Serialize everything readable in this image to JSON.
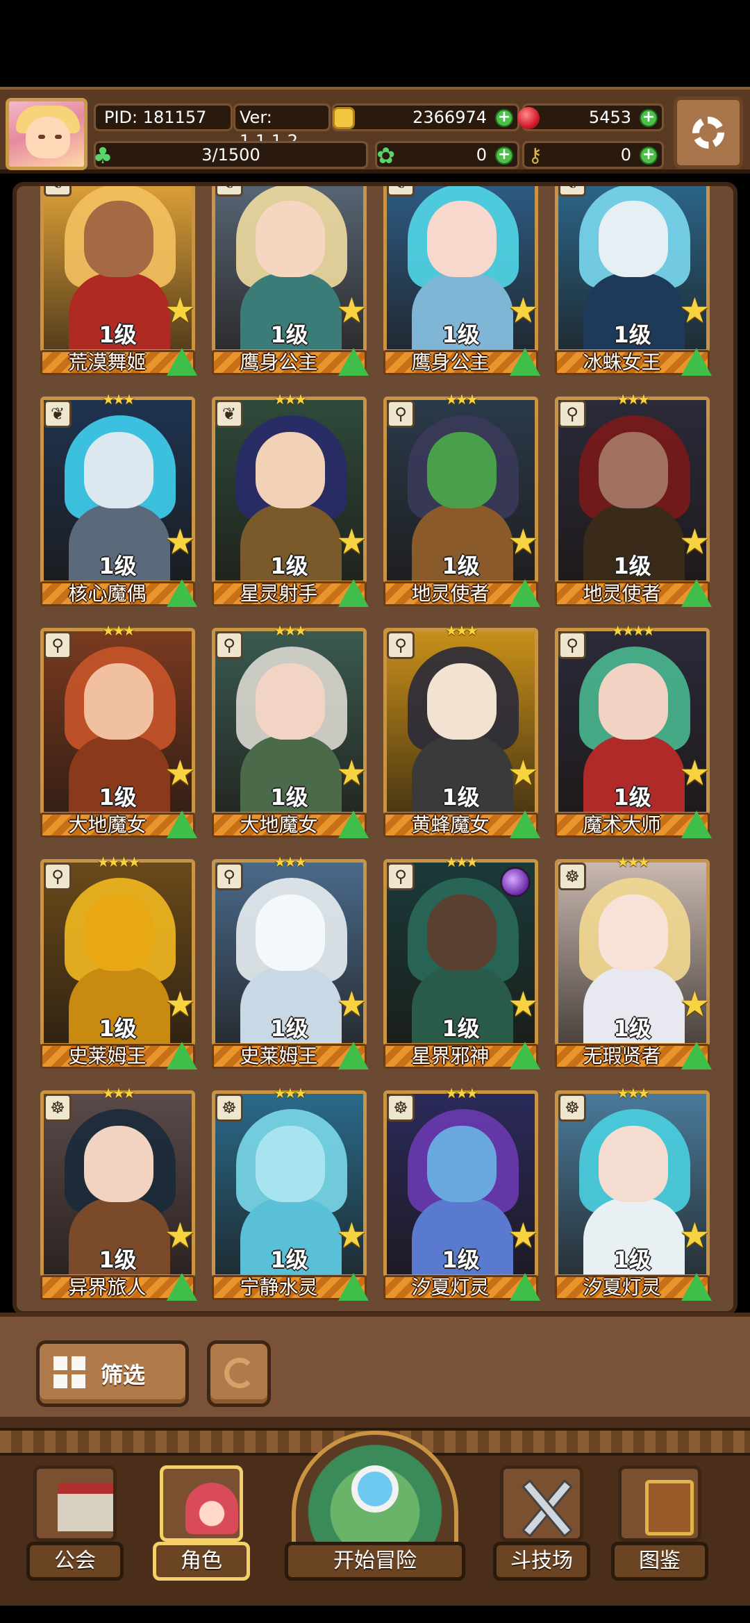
{
  "header": {
    "pid": "PID: 181157",
    "version": "Ver: 1.1.1.2",
    "gold": "2366974",
    "gems": "5453",
    "energy": "3/1500",
    "clover": "0",
    "keys": "0"
  },
  "roster": [
    {
      "level": "1级",
      "name": "荒漠舞姬",
      "stars": "★★★",
      "class_icon": "feather-icon",
      "colors": {
        "bg": "#e8a83a",
        "hair": "#f4c060",
        "skin": "#a56a44",
        "body": "#b02a24"
      }
    },
    {
      "level": "1级",
      "name": "鹰身公主",
      "stars": "★★★",
      "class_icon": "feather-icon",
      "colors": {
        "bg": "#5b6a7a",
        "hair": "#f0dca0",
        "skin": "#f5d6c0",
        "body": "#3c7c78"
      }
    },
    {
      "level": "1级",
      "name": "鹰身公主",
      "stars": "★★★",
      "class_icon": "feather-icon",
      "colors": {
        "bg": "#2f5f8a",
        "hair": "#52d7e8",
        "skin": "#f8d8cc",
        "body": "#7fb6d6"
      }
    },
    {
      "level": "1级",
      "name": "冰蛛女王",
      "stars": "★★★★★",
      "class_icon": "feather-icon",
      "colors": {
        "bg": "#2c6a90",
        "hair": "#7ad8ee",
        "skin": "#e6f0f4",
        "body": "#1e3a5a"
      }
    },
    {
      "level": "1级",
      "name": "核心魔偶",
      "stars": "★★★",
      "class_icon": "feather-icon",
      "colors": {
        "bg": "#1f3350",
        "hair": "#3fd0f0",
        "skin": "#dce8f0",
        "body": "#5a6a7a"
      }
    },
    {
      "level": "1级",
      "name": "星灵射手",
      "stars": "★★★",
      "class_icon": "feather-icon",
      "colors": {
        "bg": "#2e4a3a",
        "hair": "#2a2a6a",
        "skin": "#f2d2b6",
        "body": "#7a5a2a"
      }
    },
    {
      "level": "1级",
      "name": "地灵使者",
      "stars": "★★★",
      "class_icon": "wand-icon",
      "colors": {
        "bg": "#2a3a4a",
        "hair": "#3a3a5a",
        "skin": "#4aa04a",
        "body": "#8a5a2a"
      }
    },
    {
      "level": "1级",
      "name": "地灵使者",
      "stars": "★★★",
      "class_icon": "wand-icon",
      "colors": {
        "bg": "#2a2a3a",
        "hair": "#7a1a1a",
        "skin": "#a07060",
        "body": "#3a2a1a"
      }
    },
    {
      "level": "1级",
      "name": "大地魔女",
      "stars": "★★★",
      "class_icon": "wand-icon",
      "colors": {
        "bg": "#7a3a20",
        "hair": "#c8542a",
        "skin": "#f0c0a0",
        "body": "#8a3a1a"
      }
    },
    {
      "level": "1级",
      "name": "大地魔女",
      "stars": "★★★",
      "class_icon": "wand-icon",
      "colors": {
        "bg": "#3a5a50",
        "hair": "#dad8d0",
        "skin": "#f2d4c4",
        "body": "#4a6a4a"
      }
    },
    {
      "level": "1级",
      "name": "黄蜂魔女",
      "stars": "★★★",
      "class_icon": "wand-icon",
      "colors": {
        "bg": "#c8901a",
        "hair": "#2a2a3a",
        "skin": "#f2e2d2",
        "body": "#3a3a3a"
      }
    },
    {
      "level": "1级",
      "name": "魔术大师",
      "stars": "★★★★",
      "class_icon": "wand-icon",
      "colors": {
        "bg": "#2a2a3a",
        "hair": "#4ab890",
        "skin": "#f2d2c2",
        "body": "#b02a2a"
      }
    },
    {
      "level": "1级",
      "name": "史莱姆王",
      "stars": "★★★★",
      "class_icon": "wand-icon",
      "colors": {
        "bg": "#6a4a1a",
        "hair": "#f2b820",
        "skin": "#e8a814",
        "body": "#c88a10"
      }
    },
    {
      "level": "1级",
      "name": "史莱姆王",
      "stars": "★★★",
      "class_icon": "wand-icon",
      "colors": {
        "bg": "#4a6a8a",
        "hair": "#e8eef2",
        "skin": "#f4f8fa",
        "body": "#c8d8e4"
      }
    },
    {
      "level": "1级",
      "name": "星界邪神",
      "stars": "★★★",
      "class_icon": "wand-icon",
      "colors": {
        "bg": "#1a3a3a",
        "hair": "#2a6a5a",
        "skin": "#5a4030",
        "body": "#2a5a4a"
      },
      "orb": true
    },
    {
      "level": "1级",
      "name": "无瑕贤者",
      "stars": "★★★",
      "class_icon": "monk-icon",
      "colors": {
        "bg": "#c8b8b0",
        "hair": "#f2d890",
        "skin": "#f8e2d8",
        "body": "#e8e8f0"
      }
    },
    {
      "level": "1级",
      "name": "异界旅人",
      "stars": "★★★",
      "class_icon": "monk-icon",
      "colors": {
        "bg": "#5a4a4a",
        "hair": "#1a2a3a",
        "skin": "#f2d2c0",
        "body": "#7a4a2a"
      }
    },
    {
      "level": "1级",
      "name": "宁静水灵",
      "stars": "★★★",
      "class_icon": "monk-icon",
      "colors": {
        "bg": "#2a6a8a",
        "hair": "#7ad8e8",
        "skin": "#a8e4f0",
        "body": "#5ac0d8"
      }
    },
    {
      "level": "1级",
      "name": "汐夏灯灵",
      "stars": "★★★",
      "class_icon": "monk-icon",
      "colors": {
        "bg": "#2a2a5a",
        "hair": "#6a3ab0",
        "skin": "#6aa8e0",
        "body": "#5a7ad0"
      }
    },
    {
      "level": "1级",
      "name": "汐夏灯灵",
      "stars": "★★★",
      "class_icon": "monk-icon",
      "colors": {
        "bg": "#4a7a9a",
        "hair": "#4ad0e0",
        "skin": "#f4dcd0",
        "body": "#e8f0f4"
      }
    }
  ],
  "filter": {
    "label": "筛选"
  },
  "nav": {
    "guild": "公会",
    "role": "角色",
    "adventure": "开始冒险",
    "arena": "斗技场",
    "codex": "图鉴"
  }
}
